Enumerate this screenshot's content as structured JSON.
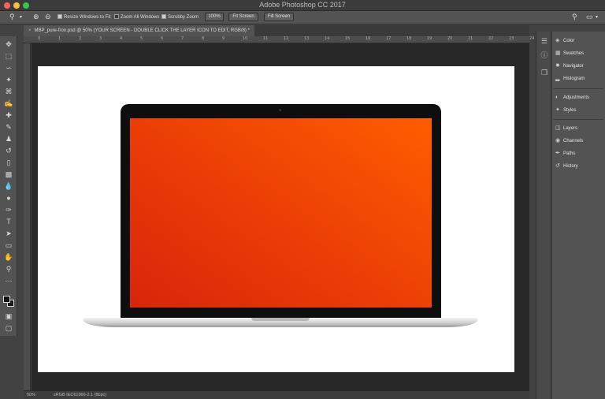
{
  "app": {
    "title": "Adobe Photoshop CC 2017"
  },
  "options_bar": {
    "resize_windows": "Resize Windows to Fit",
    "zoom_all": "Zoom All Windows",
    "scrubby_zoom": "Scrubby Zoom",
    "zoom_100": "100%",
    "fit_screen": "Fit Screen",
    "fill_screen": "Fill Screen",
    "checks": {
      "resize_windows": true,
      "zoom_all": false,
      "scrubby_zoom": true
    }
  },
  "document": {
    "tab_title": "MBP_pure-fron.psd @ 50% (YOUR SCREEN - DOUBLE CLICK THE LAYER ICON TO EDIT, RGB/8) *",
    "close": "×"
  },
  "ruler": {
    "h_labels": [
      "0",
      "1",
      "2",
      "3",
      "4",
      "5",
      "6",
      "7",
      "8",
      "9",
      "10",
      "11",
      "12",
      "13",
      "14",
      "15",
      "16",
      "17",
      "18",
      "19",
      "20",
      "21",
      "22",
      "23",
      "24"
    ]
  },
  "status": {
    "zoom": "50%",
    "profile": "sRGB IEC61966-2.1 (8bpc)"
  },
  "panels": {
    "group1": [
      {
        "label": "Color",
        "icon": "color-icon"
      },
      {
        "label": "Swatches",
        "icon": "swatches-icon"
      },
      {
        "label": "Navigator",
        "icon": "navigator-icon"
      },
      {
        "label": "Histogram",
        "icon": "histogram-icon"
      }
    ],
    "group2": [
      {
        "label": "Adjustments",
        "icon": "adjustments-icon"
      },
      {
        "label": "Styles",
        "icon": "styles-icon"
      }
    ],
    "group3": [
      {
        "label": "Layers",
        "icon": "layers-icon"
      },
      {
        "label": "Channels",
        "icon": "channels-icon"
      },
      {
        "label": "Paths",
        "icon": "paths-icon"
      },
      {
        "label": "History",
        "icon": "history-icon"
      }
    ]
  },
  "colors": {
    "screen_start": "#d8250b",
    "screen_end": "#ff5d00",
    "ui_bg": "#535353",
    "canvas_bg": "#282828"
  }
}
